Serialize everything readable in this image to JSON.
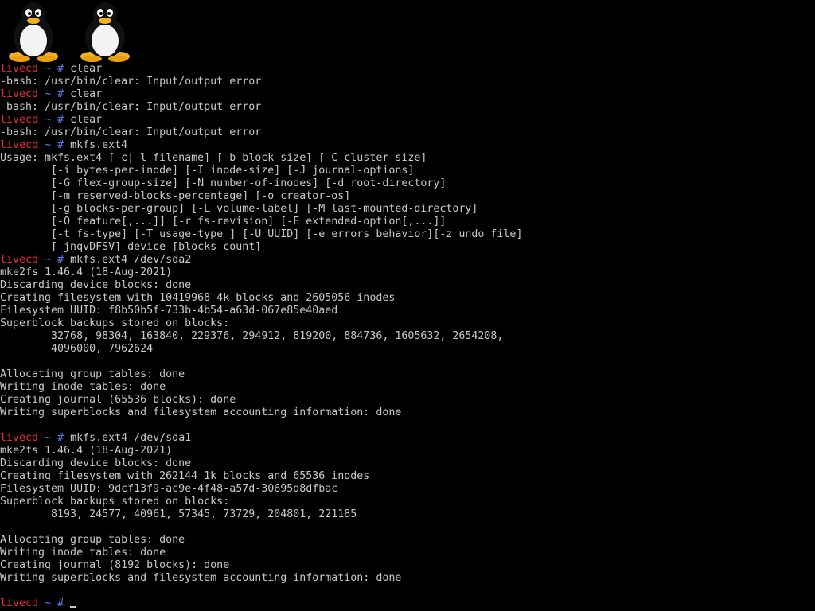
{
  "theme": {
    "background": "#000000",
    "text": "#c8c8c8",
    "prompt_host": "#e8283c",
    "prompt_symbols": "#5a7ef0"
  },
  "boot_logo": {
    "icons": [
      "tux-penguin-icon",
      "tux-penguin-icon"
    ]
  },
  "prompt": {
    "host": "livecd",
    "dir": "~",
    "symbol": "#"
  },
  "lines": [
    {
      "type": "prompt",
      "cmd": "clear"
    },
    {
      "type": "out",
      "text": "-bash: /usr/bin/clear: Input/output error"
    },
    {
      "type": "prompt",
      "cmd": "clear"
    },
    {
      "type": "out",
      "text": "-bash: /usr/bin/clear: Input/output error"
    },
    {
      "type": "prompt",
      "cmd": "clear"
    },
    {
      "type": "out",
      "text": "-bash: /usr/bin/clear: Input/output error"
    },
    {
      "type": "prompt",
      "cmd": "mkfs.ext4"
    },
    {
      "type": "out",
      "text": "Usage: mkfs.ext4 [-c|-l filename] [-b block-size] [-C cluster-size]"
    },
    {
      "type": "out",
      "text": "        [-i bytes-per-inode] [-I inode-size] [-J journal-options]"
    },
    {
      "type": "out",
      "text": "        [-G flex-group-size] [-N number-of-inodes] [-d root-directory]"
    },
    {
      "type": "out",
      "text": "        [-m reserved-blocks-percentage] [-o creator-os]"
    },
    {
      "type": "out",
      "text": "        [-g blocks-per-group] [-L volume-label] [-M last-mounted-directory]"
    },
    {
      "type": "out",
      "text": "        [-O feature[,...]] [-r fs-revision] [-E extended-option[,...]]"
    },
    {
      "type": "out",
      "text": "        [-t fs-type] [-T usage-type ] [-U UUID] [-e errors_behavior][-z undo_file]"
    },
    {
      "type": "out",
      "text": "        [-jnqvDFSV] device [blocks-count]"
    },
    {
      "type": "prompt",
      "cmd": "mkfs.ext4 /dev/sda2"
    },
    {
      "type": "out",
      "text": "mke2fs 1.46.4 (18-Aug-2021)"
    },
    {
      "type": "out",
      "text": "Discarding device blocks: done"
    },
    {
      "type": "out",
      "text": "Creating filesystem with 10419968 4k blocks and 2605056 inodes"
    },
    {
      "type": "out",
      "text": "Filesystem UUID: f8b50b5f-733b-4b54-a63d-067e85e40aed"
    },
    {
      "type": "out",
      "text": "Superblock backups stored on blocks:"
    },
    {
      "type": "out",
      "text": "        32768, 98304, 163840, 229376, 294912, 819200, 884736, 1605632, 2654208,"
    },
    {
      "type": "out",
      "text": "        4096000, 7962624"
    },
    {
      "type": "out",
      "text": ""
    },
    {
      "type": "out",
      "text": "Allocating group tables: done"
    },
    {
      "type": "out",
      "text": "Writing inode tables: done"
    },
    {
      "type": "out",
      "text": "Creating journal (65536 blocks): done"
    },
    {
      "type": "out",
      "text": "Writing superblocks and filesystem accounting information: done"
    },
    {
      "type": "out",
      "text": ""
    },
    {
      "type": "prompt",
      "cmd": "mkfs.ext4 /dev/sda1"
    },
    {
      "type": "out",
      "text": "mke2fs 1.46.4 (18-Aug-2021)"
    },
    {
      "type": "out",
      "text": "Discarding device blocks: done"
    },
    {
      "type": "out",
      "text": "Creating filesystem with 262144 1k blocks and 65536 inodes"
    },
    {
      "type": "out",
      "text": "Filesystem UUID: 9dcf13f9-ac9e-4f48-a57d-30695d8dfbac"
    },
    {
      "type": "out",
      "text": "Superblock backups stored on blocks:"
    },
    {
      "type": "out",
      "text": "        8193, 24577, 40961, 57345, 73729, 204801, 221185"
    },
    {
      "type": "out",
      "text": ""
    },
    {
      "type": "out",
      "text": "Allocating group tables: done"
    },
    {
      "type": "out",
      "text": "Writing inode tables: done"
    },
    {
      "type": "out",
      "text": "Creating journal (8192 blocks): done"
    },
    {
      "type": "out",
      "text": "Writing superblocks and filesystem accounting information: done"
    },
    {
      "type": "out",
      "text": ""
    },
    {
      "type": "prompt",
      "cmd": "",
      "cursor": true
    }
  ]
}
